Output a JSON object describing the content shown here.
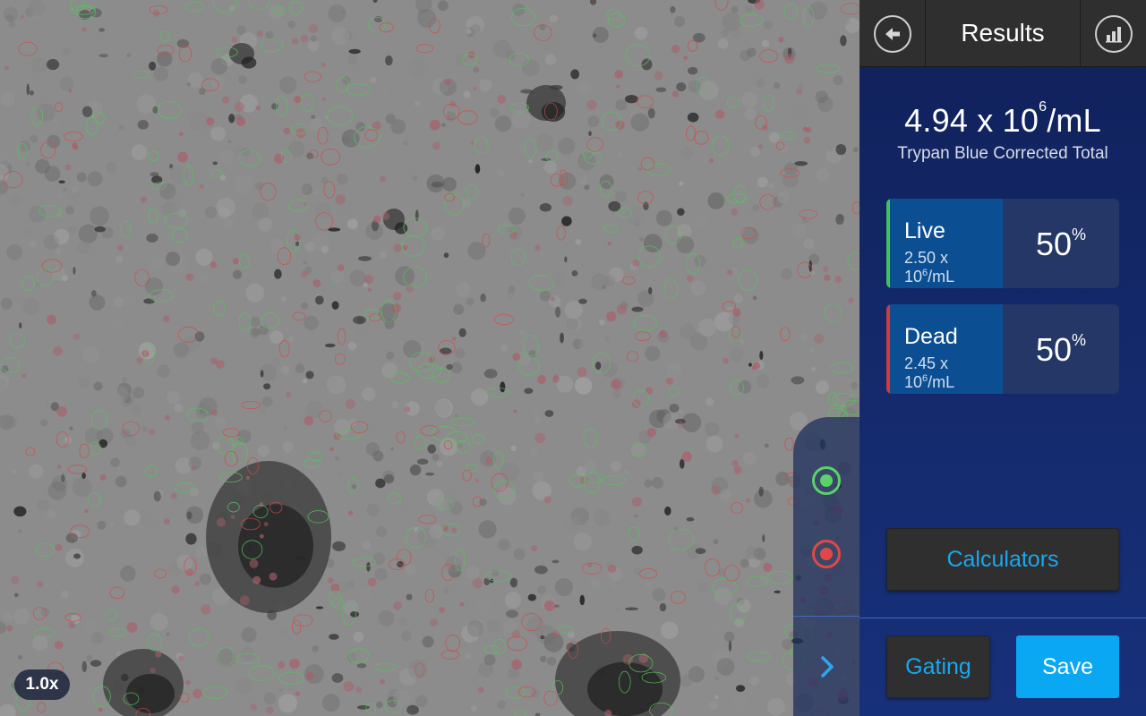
{
  "viewer": {
    "zoom_label": "1.0x"
  },
  "header": {
    "title": "Results",
    "back_icon": "arrow-left-icon",
    "chart_icon": "bar-chart-icon"
  },
  "total": {
    "value_base": "4.94 x 10",
    "value_exp": "6",
    "value_unit": "/mL",
    "label": "Trypan Blue Corrected Total"
  },
  "live": {
    "title": "Live",
    "conc_base": "2.50 x 10",
    "conc_exp": "6",
    "conc_unit": "/mL",
    "percent": "50",
    "percent_sign": "%",
    "color": "#3fc35a"
  },
  "dead": {
    "title": "Dead",
    "conc_base": "2.45 x 10",
    "conc_exp": "6",
    "conc_unit": "/mL",
    "percent": "50",
    "percent_sign": "%",
    "color": "#d23a3a"
  },
  "buttons": {
    "calculators": "Calculators",
    "gating": "Gating",
    "save": "Save"
  },
  "colors": {
    "accent": "#19a7ef",
    "save_bg": "#0aa7f2",
    "panel_bg": "#142a6c"
  }
}
